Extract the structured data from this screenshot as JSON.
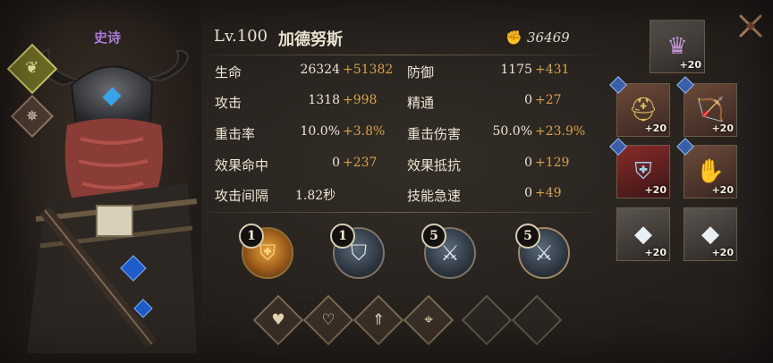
{
  "hero": {
    "rarity": "史诗",
    "level": "Lv.100",
    "name": "加德努斯",
    "power": "36469"
  },
  "stats": {
    "left": [
      {
        "label": "生命",
        "base": "26324",
        "bonus": "+51382"
      },
      {
        "label": "攻击",
        "base": "1318",
        "bonus": "+998"
      },
      {
        "label": "重击率",
        "base": "10.0%",
        "bonus": "+3.8%"
      },
      {
        "label": "效果命中",
        "base": "0",
        "bonus": "+237"
      },
      {
        "label": "攻击间隔",
        "base": "1.82秒",
        "bonus": ""
      }
    ],
    "right": [
      {
        "label": "防御",
        "base": "1175",
        "bonus": "+431"
      },
      {
        "label": "精通",
        "base": "0",
        "bonus": "+27"
      },
      {
        "label": "重击伤害",
        "base": "50.0%",
        "bonus": "+23.9%"
      },
      {
        "label": "效果抵抗",
        "base": "0",
        "bonus": "+129"
      },
      {
        "label": "技能急速",
        "base": "0",
        "bonus": "+49"
      }
    ]
  },
  "skills": [
    {
      "level": "1",
      "icon": "armor-skill-icon"
    },
    {
      "level": "1",
      "icon": "shield-skill-icon"
    },
    {
      "level": "5",
      "icon": "claw-skill-icon"
    },
    {
      "level": "5",
      "icon": "ultimate-claw-skill-icon"
    }
  ],
  "runes": [
    {
      "icon": "heart-icon"
    },
    {
      "icon": "heart-plus-icon"
    },
    {
      "icon": "arrow-up-icon"
    },
    {
      "icon": "crosshair-icon"
    },
    {
      "icon": "empty-slot"
    },
    {
      "icon": "empty-slot"
    }
  ],
  "equipment": [
    {
      "slot": "artifact",
      "level": "+20",
      "icon": "chalice-icon"
    },
    {
      "slot": "helmet",
      "level": "+20",
      "icon": "helmet-icon"
    },
    {
      "slot": "weapon",
      "level": "+20",
      "icon": "weapon-icon"
    },
    {
      "slot": "armor",
      "level": "+20",
      "icon": "armor-icon"
    },
    {
      "slot": "gloves",
      "level": "+20",
      "icon": "gloves-icon"
    },
    {
      "slot": "ring",
      "level": "+20",
      "icon": "crystal-icon"
    },
    {
      "slot": "amulet",
      "level": "+20",
      "icon": "crystal-icon"
    }
  ],
  "colors": {
    "rarity": "#b07fe0",
    "bonus": "#d6a24a",
    "text": "#ece5d4"
  }
}
